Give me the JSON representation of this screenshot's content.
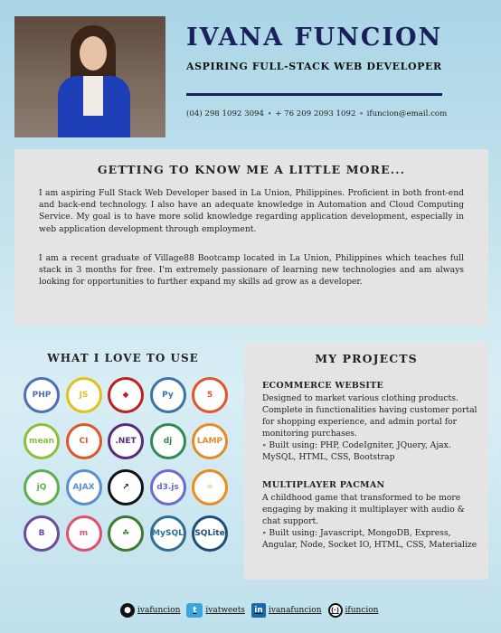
{
  "header": {
    "name": "IVANA FUNCION",
    "title": "ASPIRING FULL-STACK WEB DEVELOPER",
    "phone1": "(04) 298 1092 3094",
    "phone2": "+ 76 209 2093 1092",
    "email": "ifuncion@email.com",
    "separator": "∘"
  },
  "about": {
    "heading": "GETTING TO KNOW ME A LITTLE MORE...",
    "p1": "I am aspiring Full Stack Web Developer based in La Union, Philippines. Proficient in both front-end and back-end technology. I also have an adequate knowledge in Automation and Cloud Computing Service. My goal is to have more solid knowledge regarding application development, especially in web application development through employment.",
    "p2": "I am a recent graduate of Village88 Bootcamp located in La Union, Philippines which teaches full stack in 3 months for free. I'm extremely passionare of learning new technologies and am always looking for opportunities to further expand my skills ad grow as a developer."
  },
  "tools": {
    "heading": "WHAT I LOVE TO USE",
    "items": [
      {
        "name": "php",
        "label": "PHP",
        "color": "#4d6fb5"
      },
      {
        "name": "javascript",
        "label": "JS",
        "color": "#e0c21c"
      },
      {
        "name": "ruby",
        "label": "◆",
        "color": "#b92222"
      },
      {
        "name": "python",
        "label": "Py",
        "color": "#3c72a6"
      },
      {
        "name": "html5",
        "label": "5",
        "color": "#e0552a"
      },
      {
        "name": "mean",
        "label": "mean",
        "color": "#8bbf3c"
      },
      {
        "name": "codeigniter",
        "label": "CI",
        "color": "#e0552a"
      },
      {
        "name": "dotnet",
        "label": ".NET",
        "color": "#5a2a7a"
      },
      {
        "name": "django",
        "label": "dj",
        "color": "#2f8a52"
      },
      {
        "name": "lamp",
        "label": "LAMP",
        "color": "#e6892b"
      },
      {
        "name": "jquery",
        "label": "jQ",
        "color": "#5fae4c"
      },
      {
        "name": "ajax",
        "label": "AJAX",
        "color": "#5a8fcf"
      },
      {
        "name": "compass",
        "label": "↗",
        "color": "#111111"
      },
      {
        "name": "d3js",
        "label": "d3.js",
        "color": "#6a6ad0"
      },
      {
        "name": "swift",
        "label": "✧",
        "color": "#ef8a1e"
      },
      {
        "name": "bootstrap",
        "label": "B",
        "color": "#6a4a9c"
      },
      {
        "name": "materialize",
        "label": "m",
        "color": "#e0506a"
      },
      {
        "name": "mongodb",
        "label": "☘",
        "color": "#3f7a32"
      },
      {
        "name": "mysql",
        "label": "MySQL",
        "color": "#2e6e94"
      },
      {
        "name": "sqlite",
        "label": "SQLite",
        "color": "#1f4e79"
      }
    ]
  },
  "projects": {
    "heading": "MY PROJECTS",
    "items": [
      {
        "title": "ECOMMERCE WEBSITE",
        "desc": "Designed to market various clothing products. Complete in functionalities having customer portal for shopping experience, and admin portal for monitoring purchases.",
        "built": "∘ Built using: PHP, CodeIgniter, JQuery, Ajax. MySQL, HTML, CSS, Bootstrap"
      },
      {
        "title": "MULTIPLAYER PACMAN",
        "desc": "A childhood game that transformed to be more engaging by making it multiplayer with audio & chat support.",
        "built": "∘ Built using: Javascript, MongoDB, Express, Angular, Node, Socket IO, HTML, CSS, Materialize"
      }
    ]
  },
  "footer": {
    "links": [
      {
        "name": "github",
        "label": "ivafuncion",
        "icon": "github-icon",
        "glyph": "●"
      },
      {
        "name": "twitter",
        "label": "ivatweets",
        "icon": "twitter-icon",
        "glyph": "t"
      },
      {
        "name": "linkedin",
        "label": "ivanafuncion",
        "icon": "linkedin-icon",
        "glyph": "in"
      },
      {
        "name": "freecodecamp",
        "label": "ifuncion",
        "icon": "freecodecamp-icon",
        "glyph": "(·)"
      }
    ]
  }
}
